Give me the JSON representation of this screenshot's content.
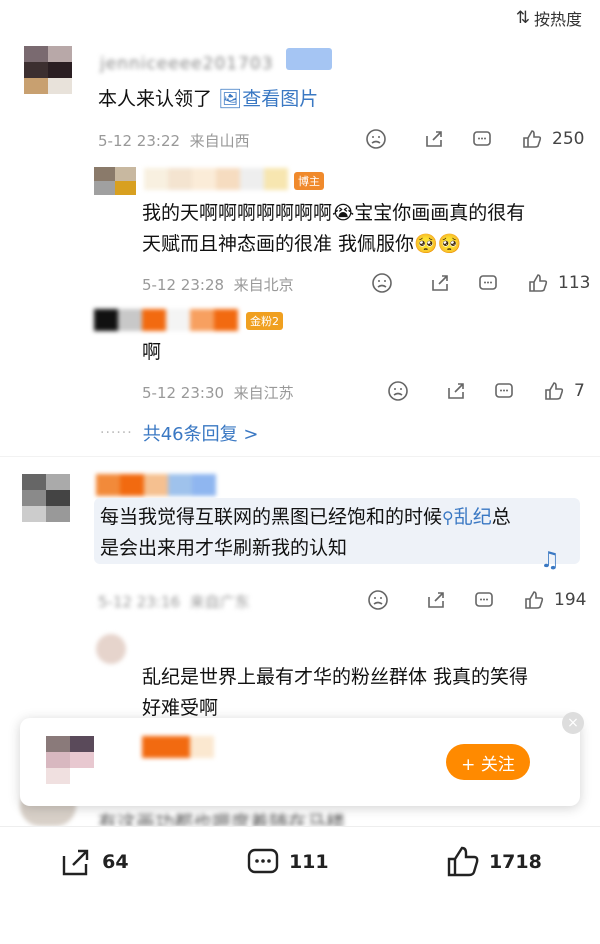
{
  "sort": {
    "label": "按热度"
  },
  "comments": [
    {
      "username": "jenniceeee201703",
      "text": "本人来认领了",
      "image_link": "查看图片",
      "date": "5-12 23:22",
      "location": "来自山西",
      "likes": "250",
      "replies": [
        {
          "badge": "博主",
          "text_line1": "我的天啊啊啊啊啊啊啊",
          "text_line1b": "宝宝你画画真的很有",
          "text_line2": "天赋而且神态画的很准 我佩服你",
          "date": "5-12 23:28",
          "location": "来自北京",
          "likes": "113"
        },
        {
          "badge": "金粉2",
          "text": "啊",
          "date": "5-12 23:30",
          "location": "来自江苏",
          "likes": "7"
        }
      ],
      "more_replies": "共46条回复 >"
    },
    {
      "text_line1a": "每当我觉得互联网的黑图已经饱和的时候",
      "search_term": "乱纪",
      "text_line1b": "总",
      "text_line2": "是会出来用才华刷新我的认知",
      "date": "5-12 23:16",
      "location": "来自广东",
      "likes": "194",
      "reply": {
        "text_line1": "乱纪是世界上最有才华的粉丝群体 我真的笑得",
        "text_line2": "好难受啊"
      }
    }
  ],
  "popup": {
    "follow_label": "+ 关注",
    "close": "×"
  },
  "partial_bottom_text": "有这画功都也嗯度着随在马楼",
  "bottom_bar": {
    "share_count": "64",
    "comment_count": "111",
    "like_count": "1718"
  },
  "colors": {
    "accent": "#ff8a00",
    "link": "#3a78c3",
    "meta": "#999999"
  }
}
